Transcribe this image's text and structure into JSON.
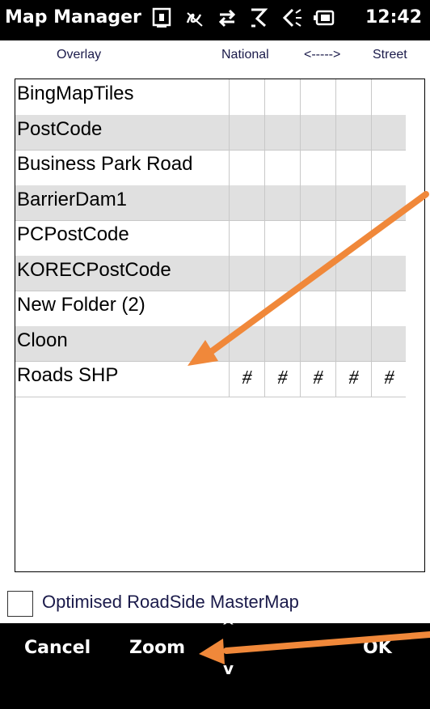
{
  "titlebar": {
    "title": "Map Manager",
    "clock": "12:42",
    "status_icons": [
      "keyboard-icon",
      "connectivity-icon",
      "sync-icon",
      "signal-icon",
      "volume-icon",
      "battery-icon"
    ]
  },
  "columns": {
    "overlay": "Overlay",
    "national": "National",
    "arrow": "<----->",
    "street": "Street"
  },
  "rows": [
    {
      "name": "BingMapTiles",
      "cells": [
        "",
        "",
        "",
        "",
        ""
      ]
    },
    {
      "name": "PostCode",
      "cells": [
        "",
        "",
        "",
        "",
        ""
      ]
    },
    {
      "name": "Business Park Road",
      "cells": [
        "",
        "",
        "",
        "",
        ""
      ]
    },
    {
      "name": "BarrierDam1",
      "cells": [
        "",
        "",
        "",
        "",
        ""
      ]
    },
    {
      "name": "PCPostCode",
      "cells": [
        "",
        "",
        "",
        "",
        ""
      ]
    },
    {
      "name": "KORECPostCode",
      "cells": [
        "",
        "",
        "",
        "",
        ""
      ]
    },
    {
      "name": "New Folder (2)",
      "cells": [
        "",
        "",
        "",
        "",
        ""
      ]
    },
    {
      "name": "Cloon",
      "cells": [
        "",
        "",
        "",
        "",
        ""
      ]
    },
    {
      "name": "Roads SHP",
      "cells": [
        "#",
        "#",
        "#",
        "#",
        "#"
      ]
    }
  ],
  "option": {
    "label": "Optimised RoadSide MasterMap",
    "checked": false
  },
  "bottombar": {
    "cancel": "Cancel",
    "zoom": "Zoom",
    "up": "^",
    "down": "v",
    "ok": "OK"
  },
  "colors": {
    "bar_background": "#000000",
    "row_alt": "#e0e0e0",
    "annotation_arrow": "#f0883a"
  }
}
